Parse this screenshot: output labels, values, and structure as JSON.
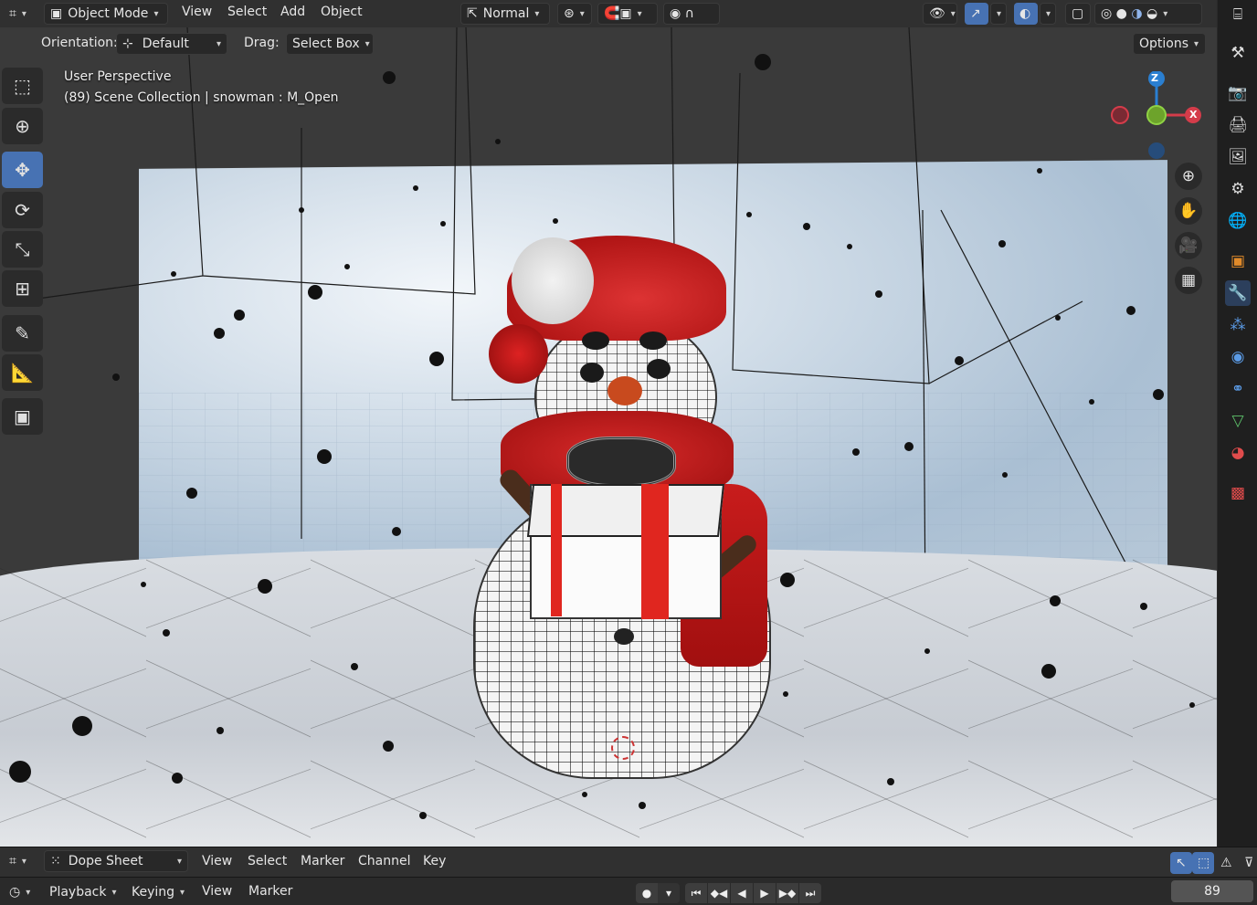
{
  "header": {
    "mode_label": "Object Mode",
    "menus": [
      "View",
      "Select",
      "Add",
      "Object"
    ],
    "transform_orientation": "Normal",
    "editor_icon": "editor-type-icon"
  },
  "tool_options": {
    "orientation_label": "Orientation:",
    "orientation_value": "Default",
    "drag_label": "Drag:",
    "drag_value": "Select Box",
    "options_label": "Options"
  },
  "viewport": {
    "perspective": "User Perspective",
    "collection_info": "(89) Scene Collection | snowman : M_Open",
    "gizmo": {
      "z": "Z",
      "y": "Y",
      "x": "X"
    }
  },
  "dopesheet": {
    "editor_label": "Dope Sheet",
    "menus": [
      "View",
      "Select",
      "Marker",
      "Channel",
      "Key"
    ]
  },
  "timeline": {
    "menus": [
      "Playback",
      "Keying",
      "View",
      "Marker"
    ],
    "current_frame": "89"
  },
  "colors": {
    "accent": "#4772b3",
    "header_bg": "#303030",
    "panel_bg": "#1d1d1d",
    "axis_x": "#d43c4a",
    "axis_y": "#6da32b",
    "axis_z": "#2a7fd1"
  }
}
